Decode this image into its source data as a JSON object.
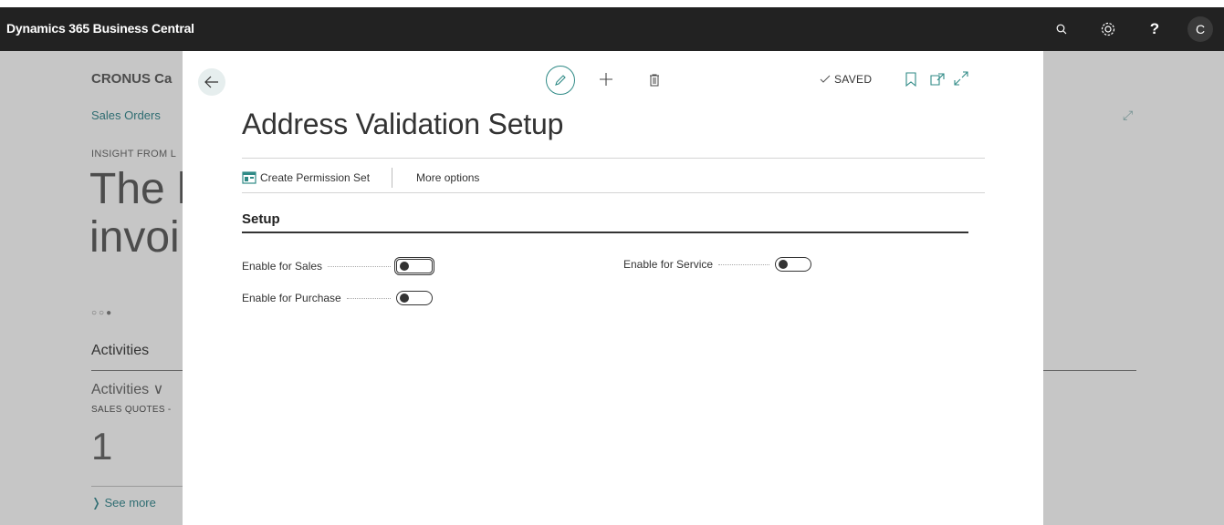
{
  "app": {
    "title": "Dynamics 365 Business Central",
    "avatar_initial": "C"
  },
  "icons": {
    "search": "search-icon",
    "settings": "gear-icon",
    "help": "help-icon"
  },
  "background": {
    "company": "CRONUS Ca",
    "link": "Sales Orders",
    "insight": "INSIGHT FROM L",
    "headline_1": "The l",
    "headline_2": "invoi",
    "dots": "○○●",
    "activities": "Activities",
    "activities_dropdown": "Activities ∨",
    "sales_quotes": "SALES QUOTES -",
    "count": "1",
    "see_more": "❭ See more"
  },
  "modal": {
    "title": "Address Validation Setup",
    "status": "SAVED",
    "actions": {
      "create_permission_set": "Create Permission Set",
      "more_options": "More options"
    },
    "section": {
      "title": "Setup",
      "fields": [
        {
          "label": "Enable for Sales",
          "value": false
        },
        {
          "label": "Enable for Purchase",
          "value": false
        },
        {
          "label": "Enable for Service",
          "value": false
        }
      ]
    }
  },
  "colors": {
    "topbar": "#222222",
    "accent": "#2f8a86",
    "link": "#2f6d72"
  }
}
